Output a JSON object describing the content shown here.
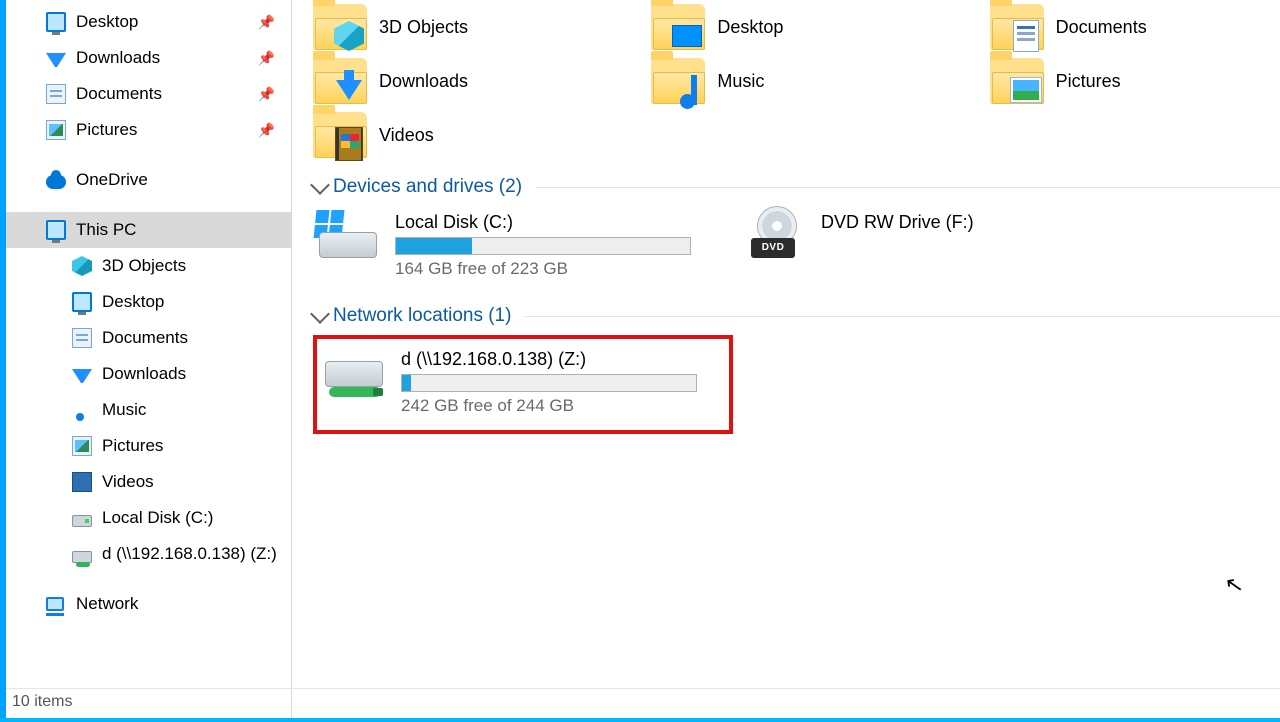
{
  "sidebar": {
    "quick": [
      {
        "label": "Desktop",
        "pinned": true,
        "icon": "monitor"
      },
      {
        "label": "Downloads",
        "pinned": true,
        "icon": "down"
      },
      {
        "label": "Documents",
        "pinned": true,
        "icon": "doc"
      },
      {
        "label": "Pictures",
        "pinned": true,
        "icon": "pic"
      }
    ],
    "onedrive": "OneDrive",
    "this_pc": "This PC",
    "pc_children": [
      {
        "label": "3D Objects",
        "icon": "cube"
      },
      {
        "label": "Desktop",
        "icon": "monitor"
      },
      {
        "label": "Documents",
        "icon": "doc"
      },
      {
        "label": "Downloads",
        "icon": "down"
      },
      {
        "label": "Music",
        "icon": "note"
      },
      {
        "label": "Pictures",
        "icon": "pic"
      },
      {
        "label": "Videos",
        "icon": "video"
      },
      {
        "label": "Local Disk (C:)",
        "icon": "disk"
      },
      {
        "label": "d (\\\\192.168.0.138) (Z:)",
        "icon": "netdrive"
      }
    ],
    "network": "Network"
  },
  "content": {
    "folders": [
      [
        {
          "label": "3D Objects",
          "overlay": "cube"
        },
        {
          "label": "Desktop",
          "overlay": "desk"
        },
        {
          "label": "Documents",
          "overlay": "doc"
        }
      ],
      [
        {
          "label": "Downloads",
          "overlay": "down"
        },
        {
          "label": "Music",
          "overlay": "music"
        },
        {
          "label": "Pictures",
          "overlay": "pic"
        }
      ],
      [
        {
          "label": "Videos",
          "overlay": "vid"
        }
      ]
    ],
    "group_devices": "Devices and drives (2)",
    "drives": [
      {
        "name": "Local Disk (C:)",
        "free": "164 GB free of 223 GB",
        "fill_pct": 26,
        "icon": "hddwin"
      },
      {
        "name": "DVD RW Drive (F:)",
        "free": "",
        "fill_pct": null,
        "icon": "dvd"
      }
    ],
    "group_network": "Network locations (1)",
    "net_drives": [
      {
        "name": "d (\\\\192.168.0.138) (Z:)",
        "free": "242 GB free of 244 GB",
        "fill_pct": 1,
        "highlight": true
      }
    ]
  },
  "status": {
    "items": "10 items"
  }
}
